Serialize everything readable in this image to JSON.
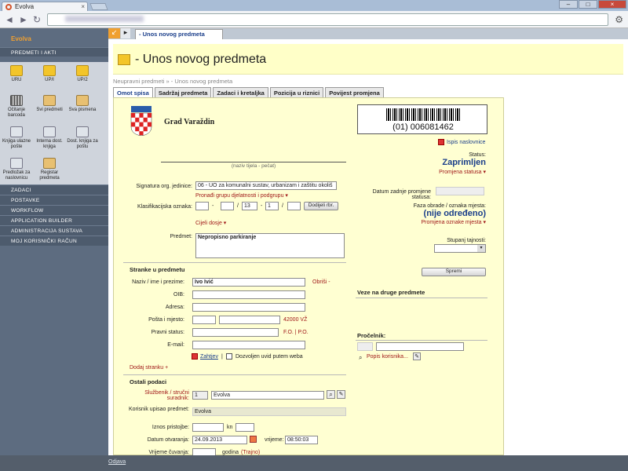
{
  "browser": {
    "tab_title": "Evolva",
    "tab_close": "×",
    "win_min": "–",
    "win_max": "□",
    "win_close": "×",
    "back": "◄",
    "forward": "►",
    "reload": "↻",
    "wrench": "⚙"
  },
  "sidebar": {
    "brand": "Evolva",
    "section": "PREDMETI I AKTI",
    "icons": [
      {
        "label": "URU",
        "icon": "folder-icon"
      },
      {
        "label": "UP/I",
        "icon": "folder-icon"
      },
      {
        "label": "UP/2",
        "icon": "folder-icon"
      },
      {
        "label": "Očitanje barcoda",
        "icon": "barcode-icon"
      },
      {
        "label": "Svi predmeti",
        "icon": "documents-icon"
      },
      {
        "label": "Sva pismena",
        "icon": "documents-icon"
      },
      {
        "label": "Knjiga ulazne pošte",
        "icon": "scanner-icon"
      },
      {
        "label": "Interna dost. knjiga",
        "icon": "pen-icon"
      },
      {
        "label": "Dost. knjiga za poštu",
        "icon": "mail-book-icon"
      },
      {
        "label": "Predložak za naslovnicu",
        "icon": "printer-icon"
      },
      {
        "label": "Registar predmeta",
        "icon": "register-icon"
      }
    ],
    "menu": [
      "ZADACI",
      "POSTAVKE",
      "WORKFLOW",
      "APPLICATION BUILDER",
      "ADMINISTRACIJA SUSTAVA",
      "MOJ KORISNIČKI RAČUN"
    ]
  },
  "main": {
    "tab_arrow": "↙",
    "tab_arrow2": "▸",
    "open_tab": "- Unos novog predmeta",
    "page_title": "- Unos novog predmeta",
    "breadcrumb": "Neupravni predmeti » - Unos novog predmeta",
    "form_tabs": [
      "Omot spisa",
      "Sadržaj predmeta",
      "Zadaci i kretaljka",
      "Pozicija u riznici",
      "Povijest promjena"
    ]
  },
  "form": {
    "org_name": "Grad Varaždin",
    "org_caption": "(naziv tijela - pečat)",
    "signatura_label": "Signatura org. jedinice:",
    "signatura_value": "06 - UO za komunalni sustav, urbanizam i zaštitu okoliš",
    "find_group": "Pronađi grupu djelatnosti i podgrupu ▾",
    "klas_label": "Klasifikacijska oznaka:",
    "klas_values": [
      "",
      "",
      "13",
      "1",
      ""
    ],
    "klas_sep": [
      "-",
      "/",
      "-",
      "/"
    ],
    "assign_button": "Dodijeli rbr.",
    "file_select": "Cijeli dosje ▾",
    "subject_label": "Predmet:",
    "subject_value": "Nepropisno parkiranje",
    "parties_header": "Stranke u predmetu",
    "name_label": "Naziv / ime i prezime:",
    "name_value": "Ivo Ivić",
    "delete_link": "Obriši -",
    "oib_label": "OIB:",
    "address_label": "Adresa:",
    "post_label": "Pošta i mjesto:",
    "post_hint": "42000 VŽ",
    "legal_label": "Pravni status:",
    "legal_hint": "F.O. | P.O.",
    "email_label": "E-mail:",
    "zahtjev_link": "Zahtjev",
    "web_checkbox": "Dozvoljen uvid putem weba",
    "add_party": "Dodaj stranku +",
    "other_header": "Ostali podaci",
    "official_label": "Službenik / stručni suradnik:",
    "official_id": "1",
    "official_value": "Evolva",
    "user_label": "Korisnik upisao predmet:",
    "user_value": "Evolva",
    "amount_label": "Iznos pristojbe:",
    "currency": "kn",
    "opened_label": "Datum otvaranja:",
    "opened_date": "24.09.2013",
    "time_label": "vrijeme:",
    "opened_time": "08:50:03",
    "retention_label": "Vrijeme čuvanja:",
    "retention_unit": "godina",
    "retention_hint": "(Trajno)"
  },
  "right": {
    "barcode_number": "(01) 006081462",
    "print_cover": "Ispis naslovnice",
    "status_label": "Status:",
    "status_value": "Zaprimljen",
    "status_change": "Promjena statusa ▾",
    "last_change_label": "Datum zadnje promjene statusa:",
    "phase_label": "Faza obrade / oznaka mjesta:",
    "phase_value": "(nije određeno)",
    "phase_change": "Promjena oznake mjesta ▾",
    "secrecy_label": "Stupanj tajnosti:",
    "save_button": "Spremi",
    "links_header": "Veze na druge predmete",
    "head_header": "Pročelnik:",
    "users_link": "Popis korisnika..."
  },
  "footer": {
    "logout": "Odjava"
  },
  "colors": {
    "sidebar": "#5d6c80",
    "panel": "#ffffd2",
    "accent": "#f0a030",
    "link": "#a01818",
    "status": "#1a3e8a"
  }
}
